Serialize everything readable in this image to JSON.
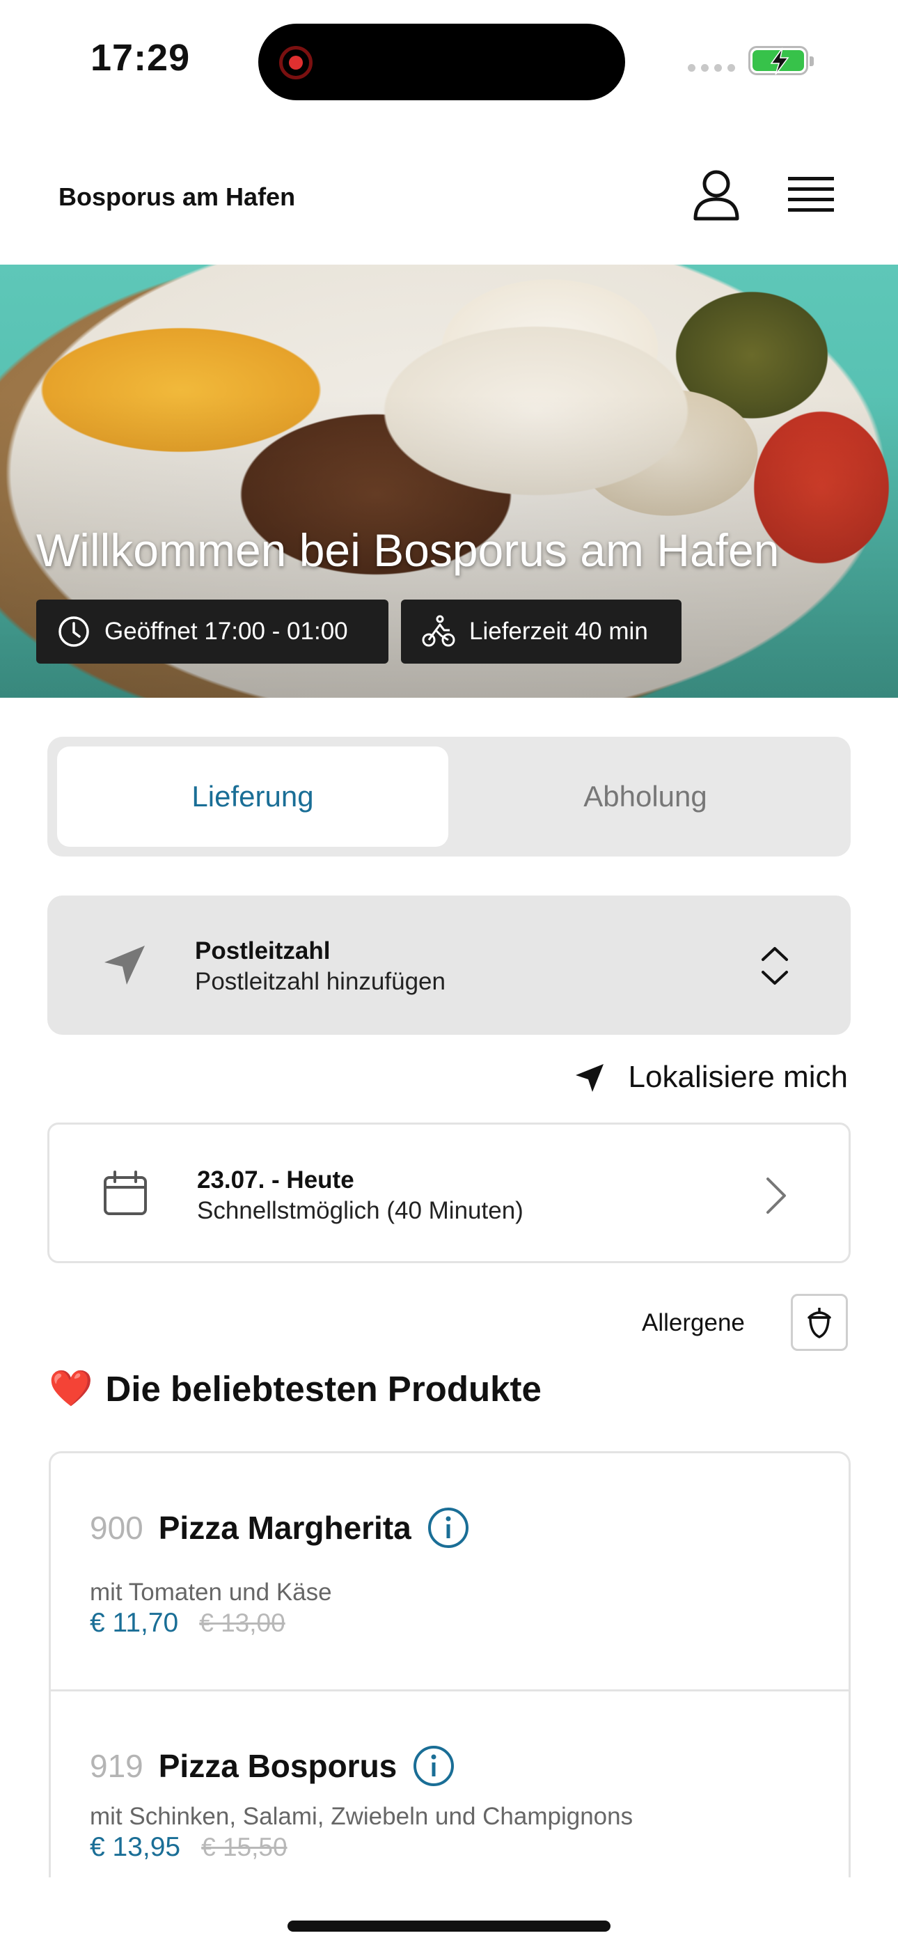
{
  "status_bar": {
    "time": "17:29"
  },
  "header": {
    "brand": "Bosporus am Hafen"
  },
  "hero": {
    "title": "Willkommen bei Bosporus am Hafen",
    "opening_hours": "Geöffnet 17:00 - 01:00",
    "delivery_time": "Lieferzeit 40 min"
  },
  "order_mode": {
    "options": [
      "Lieferung",
      "Abholung"
    ],
    "selected": "Lieferung"
  },
  "zip": {
    "label": "Postleitzahl",
    "placeholder": "Postleitzahl hinzufügen"
  },
  "locate_label": "Lokalisiere mich",
  "date": {
    "title": "23.07. - Heute",
    "subtitle": "Schnellstmöglich (40 Minuten)"
  },
  "allergens_label": "Allergene",
  "section": {
    "emoji": "❤️",
    "title": "Die beliebtesten Produkte"
  },
  "products": [
    {
      "number": "900",
      "name": "Pizza Margherita",
      "description": "mit Tomaten und Käse",
      "price": "€ 11,70",
      "old_price": "€ 13,00"
    },
    {
      "number": "919",
      "name": "Pizza Bosporus",
      "description": "mit Schinken, Salami, Zwiebeln und Champignons",
      "price": "€ 13,95",
      "old_price": "€ 15,50"
    }
  ],
  "colors": {
    "accent": "#1a6e96",
    "pill_bg": "#1e1e1e",
    "segment_bg": "#e8e8e8"
  }
}
